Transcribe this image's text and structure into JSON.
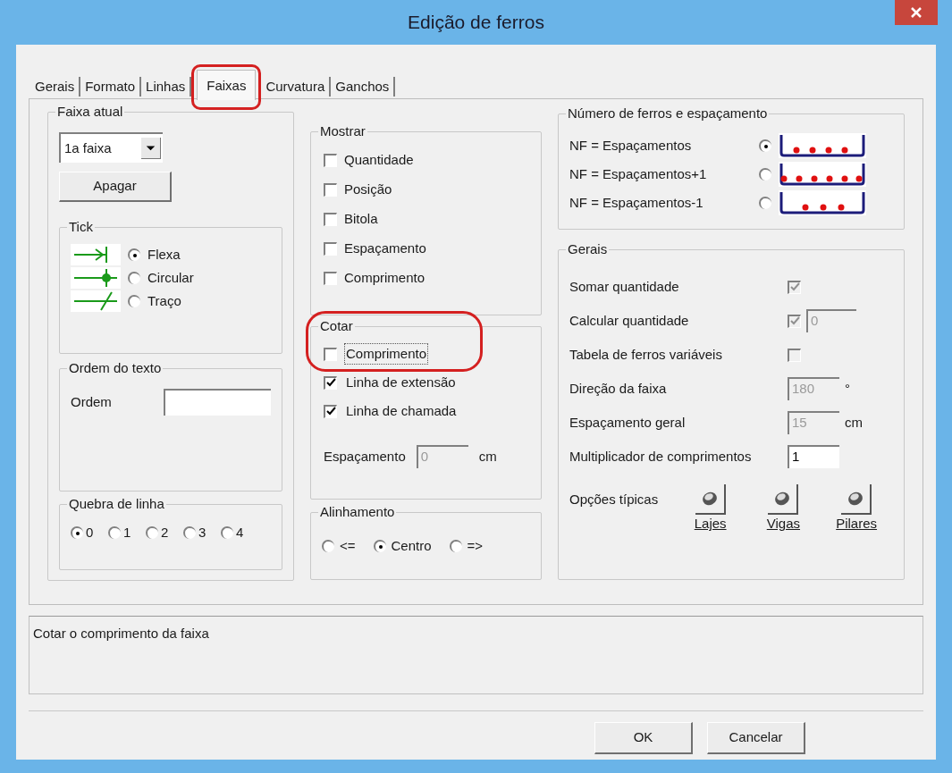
{
  "window": {
    "title": "Edição de ferros"
  },
  "tabs": [
    {
      "label": "Gerais",
      "selected": false
    },
    {
      "label": "Formato",
      "selected": false
    },
    {
      "label": "Linhas",
      "selected": false
    },
    {
      "label": "Faixas",
      "selected": true
    },
    {
      "label": "Curvatura",
      "selected": false
    },
    {
      "label": "Ganchos",
      "selected": false
    }
  ],
  "faixa_atual": {
    "title": "Faixa atual",
    "dropdown": {
      "value": "1a faixa"
    },
    "delete_button": "Apagar",
    "tick": {
      "title": "Tick",
      "options": [
        {
          "label": "Flexa",
          "selected": true,
          "kind": "arrow"
        },
        {
          "label": "Circular",
          "selected": false,
          "kind": "circle"
        },
        {
          "label": "Traço",
          "selected": false,
          "kind": "slash"
        }
      ]
    },
    "text_order": {
      "title": "Ordem do texto",
      "label": "Ordem"
    },
    "line_break": {
      "title": "Quebra de linha",
      "options": [
        {
          "label": "0",
          "selected": true
        },
        {
          "label": "1",
          "selected": false
        },
        {
          "label": "2",
          "selected": false
        },
        {
          "label": "3",
          "selected": false
        },
        {
          "label": "4",
          "selected": false
        }
      ]
    }
  },
  "mostrar": {
    "title": "Mostrar",
    "items": [
      {
        "label": "Quantidade",
        "checked": false
      },
      {
        "label": "Posição",
        "checked": false
      },
      {
        "label": "Bitola",
        "checked": false
      },
      {
        "label": "Espaçamento",
        "checked": false
      },
      {
        "label": "Comprimento",
        "checked": false
      }
    ]
  },
  "cotar": {
    "title": "Cotar",
    "items": [
      {
        "label": "Comprimento",
        "checked": false,
        "focused": true
      },
      {
        "label": "Linha de extensão",
        "checked": true,
        "focused": false
      },
      {
        "label": "Linha de chamada",
        "checked": true,
        "focused": false
      }
    ],
    "spacing": {
      "label": "Espaçamento",
      "value": "0",
      "unit": "cm",
      "disabled": true
    }
  },
  "alinhamento": {
    "title": "Alinhamento",
    "options": [
      {
        "label": "<=",
        "selected": false
      },
      {
        "label": "Centro",
        "selected": true
      },
      {
        "label": "=>",
        "selected": false
      }
    ]
  },
  "bar_count": {
    "title": "Número de ferros e espaçamento",
    "options": [
      {
        "label": "NF = Espaçamentos",
        "selected": true,
        "kind": "equal"
      },
      {
        "label": "NF = Espaçamentos+1",
        "selected": false,
        "kind": "plus"
      },
      {
        "label": "NF = Espaçamentos-1",
        "selected": false,
        "kind": "minus"
      }
    ]
  },
  "gerais": {
    "title": "Gerais",
    "rows": [
      {
        "kind": "checkbox",
        "label": "Somar quantidade",
        "checked": true,
        "disabled": true
      },
      {
        "kind": "checkbox_field",
        "label": "Calcular quantidade",
        "checked": true,
        "disabled": true,
        "value": "0"
      },
      {
        "kind": "checkbox",
        "label": "Tabela de ferros variáveis",
        "checked": false,
        "disabled": true
      },
      {
        "kind": "field",
        "label": "Direção da faixa",
        "value": "180",
        "unit": "°",
        "disabled": true
      },
      {
        "kind": "field",
        "label": "Espaçamento geral",
        "value": "15",
        "unit": "cm",
        "disabled": true
      },
      {
        "kind": "field",
        "label": "Multiplicador de comprimentos",
        "value": "1",
        "disabled": false
      }
    ],
    "typical": {
      "label": "Opções típicas",
      "buttons": [
        "Lajes",
        "Vigas",
        "Pilares"
      ]
    }
  },
  "status": "Cotar o comprimento da faixa",
  "buttons": [
    "OK",
    "Cancelar"
  ]
}
